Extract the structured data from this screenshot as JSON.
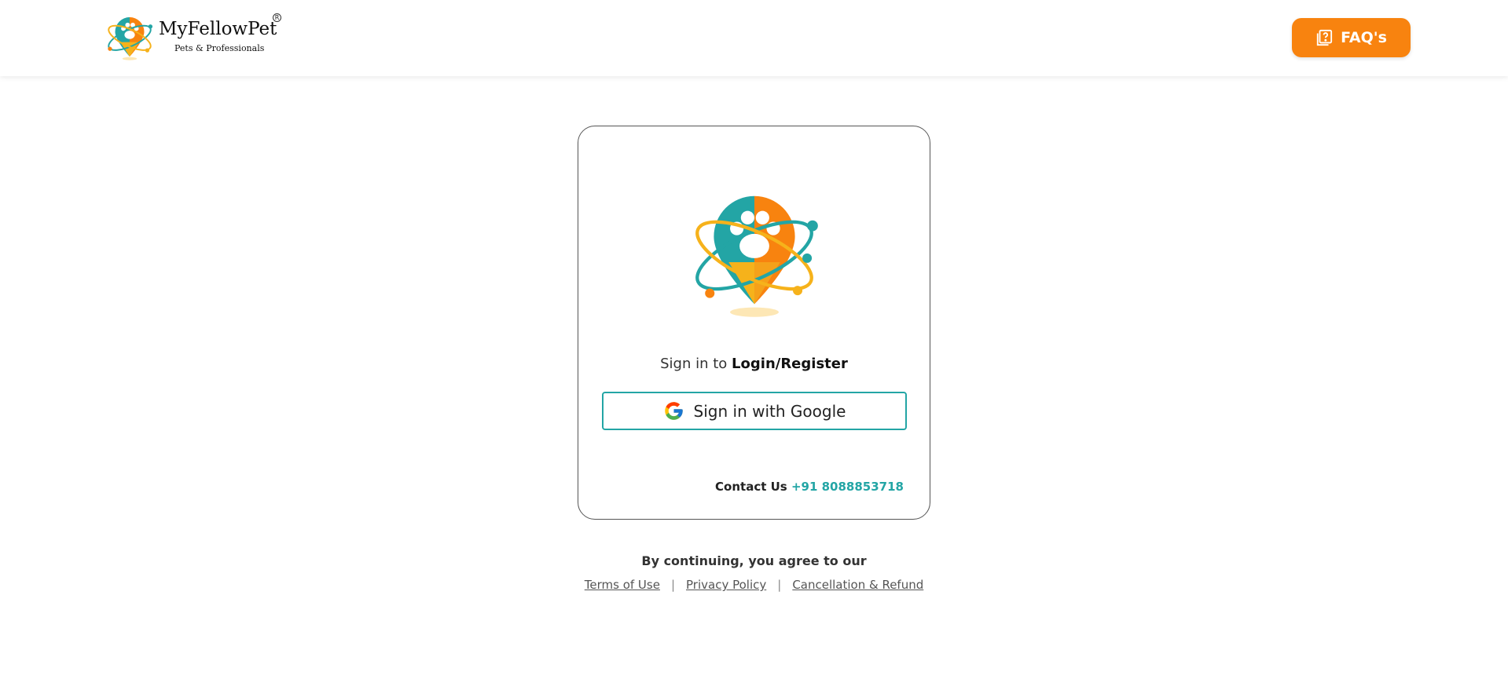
{
  "header": {
    "brand_name": "MyFellowPet",
    "brand_tagline": "Pets & Professionals",
    "brand_registered": "R",
    "faq_label": "FAQ's"
  },
  "login_card": {
    "signin_prefix": "Sign in to",
    "signin_target": "Login/Register",
    "google_button_label": "Sign in with Google",
    "contact_label": "Contact Us",
    "contact_phone": "+91 8088853718"
  },
  "footer": {
    "agree_text": "By continuing, you agree to our",
    "links": [
      {
        "label": "Terms of Use"
      },
      {
        "label": "Privacy Policy"
      },
      {
        "label": "Cancellation & Refund"
      }
    ],
    "separator": "|"
  },
  "colors": {
    "primary_orange": "#f8830f",
    "teal": "#23a5a5",
    "yellow": "#f6b21b"
  }
}
